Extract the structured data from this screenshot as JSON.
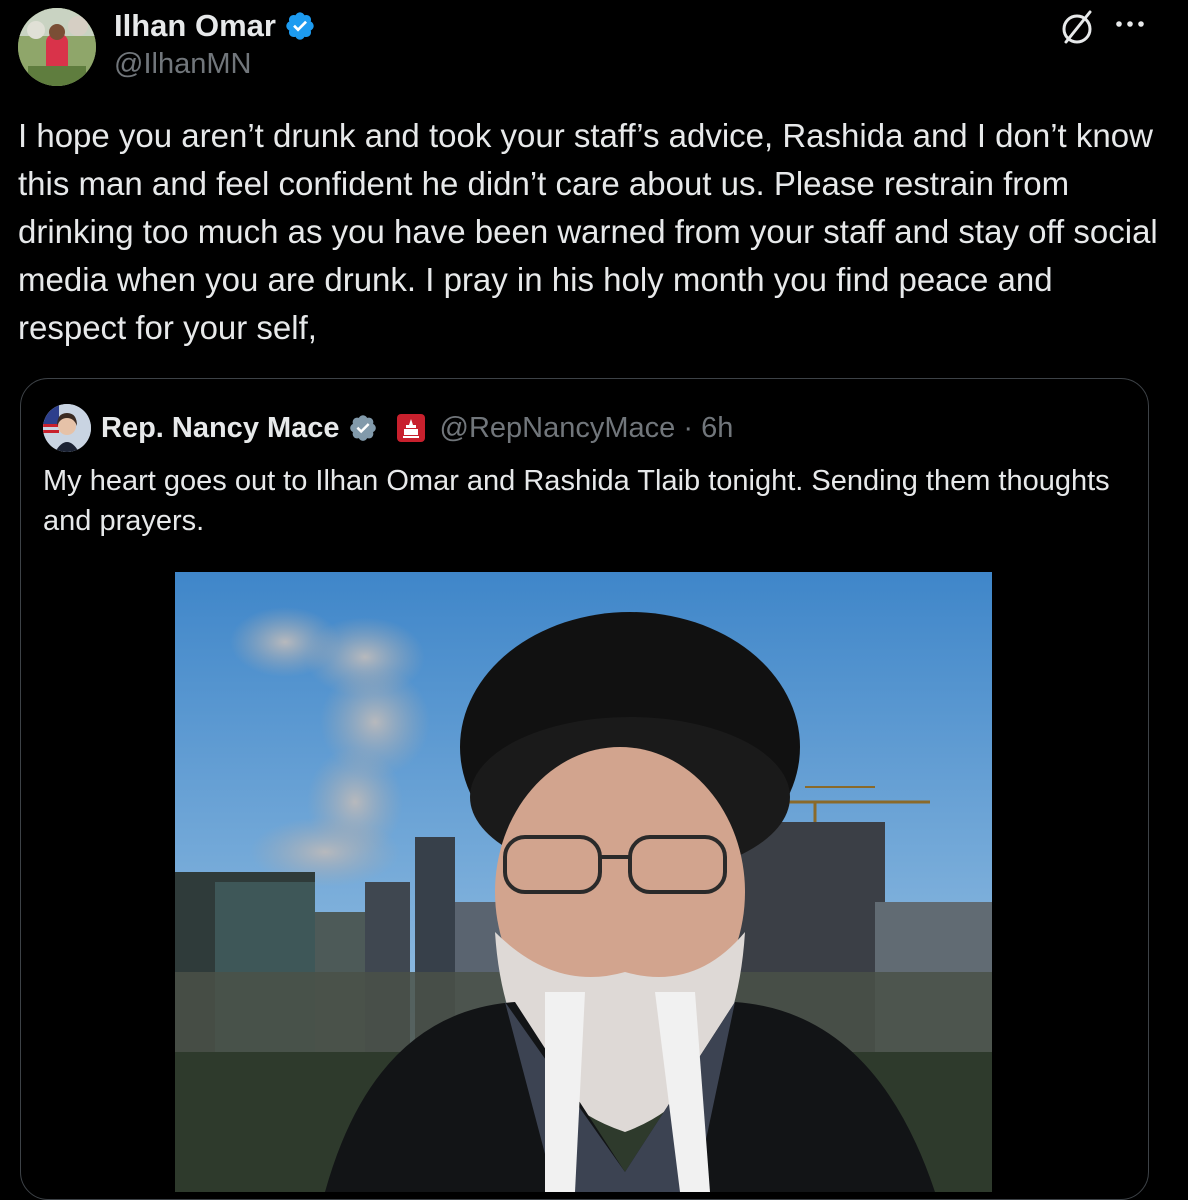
{
  "tweet": {
    "author_name": "Ilhan Omar",
    "author_handle": "@IlhanMN",
    "verified_icon": "verified-badge-icon",
    "grok_icon": "grok-icon",
    "more_icon": "more-options-icon",
    "text": "I hope you aren’t drunk and took your staff’s advice, Rashida and I don’t know this man and feel confident he didn’t care about us. Please restrain from drinking too much as you have been warned from your staff and stay off social media when you are drunk. I pray in his holy month you find peace and respect for your self,"
  },
  "quoted_tweet": {
    "author_name": "Rep. Nancy Mace",
    "author_handle_time": "@RepNancyMace · 6h",
    "text": "My heart goes out to Ilhan Omar and Rashida Tlaib tonight. Sending them thoughts and prayers.",
    "badges": [
      "verified-gray-icon",
      "capitol-badge-icon"
    ]
  },
  "colors": {
    "background": "#000000",
    "text_primary": "#e7e9ea",
    "text_secondary": "#71767b",
    "verified_blue": "#1d9bf0",
    "card_border": "#3d4247",
    "capitol_red": "#c8202d"
  }
}
